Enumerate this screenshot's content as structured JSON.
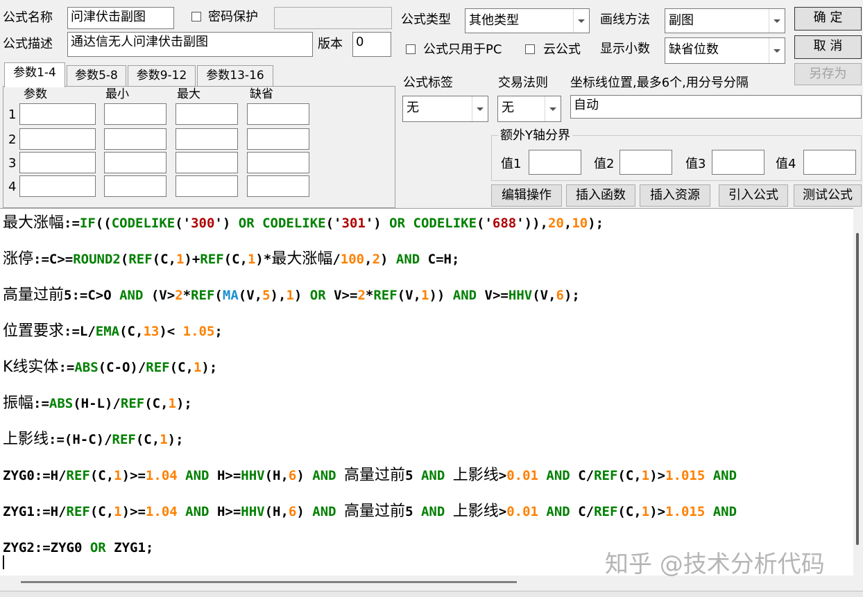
{
  "header": {
    "name_label": "公式名称",
    "name_value": "问津伏击副图",
    "password_label": "密码保护",
    "password_checked": false,
    "desc_label": "公式描述",
    "desc_value": "通达信无人问津伏击副图",
    "version_label": "版本",
    "version_value": "0",
    "type_label": "公式类型",
    "type_value": "其他类型",
    "draw_label": "画线方法",
    "draw_value": "副图",
    "pc_only_label": "公式只用于PC",
    "pc_only_checked": false,
    "cloud_label": "云公式",
    "cloud_checked": false,
    "decimals_label": "显示小数",
    "decimals_value": "缺省位数"
  },
  "buttons": {
    "ok": "确  定",
    "cancel": "取  消",
    "save_as": "另存为",
    "edit_ops": "编辑操作",
    "insert_func": "插入函数",
    "insert_res": "插入资源",
    "import_formula": "引入公式",
    "test_formula": "测试公式"
  },
  "tabs": [
    "参数1-4",
    "参数5-8",
    "参数9-12",
    "参数13-16"
  ],
  "params": {
    "headers": [
      "参数",
      "最小",
      "最大",
      "缺省"
    ],
    "rows": [
      "1",
      "2",
      "3",
      "4"
    ]
  },
  "right": {
    "tag_label": "公式标签",
    "tag_value": "无",
    "rule_label": "交易法则",
    "rule_value": "无",
    "axis_label": "坐标线位置,最多6个,用分号分隔",
    "axis_value": "自动",
    "yaxis_group": "额外Y轴分界",
    "v1": "值1",
    "v2": "值2",
    "v3": "值3",
    "v4": "值4"
  },
  "code": [
    [
      [
        "最大涨幅",
        "cn"
      ],
      [
        ":=",
        ""
      ],
      [
        "IF",
        "f"
      ],
      [
        "((",
        ""
      ],
      [
        "CODELIKE",
        "f"
      ],
      [
        "('",
        ""
      ],
      [
        "300",
        "s"
      ],
      [
        "') ",
        ""
      ],
      [
        "OR",
        "f"
      ],
      [
        " ",
        ""
      ],
      [
        "CODELIKE",
        "f"
      ],
      [
        "('",
        ""
      ],
      [
        "301",
        "s"
      ],
      [
        "') ",
        ""
      ],
      [
        "OR",
        "f"
      ],
      [
        " ",
        ""
      ],
      [
        "CODELIKE",
        "f"
      ],
      [
        "('",
        ""
      ],
      [
        "688",
        "s"
      ],
      [
        "')),",
        ""
      ],
      [
        "20",
        "n"
      ],
      [
        ",",
        ""
      ],
      [
        "10",
        "n"
      ],
      [
        ");",
        ""
      ]
    ],
    [
      [
        "涨停",
        "cn"
      ],
      [
        ":=C>=",
        ""
      ],
      [
        "ROUND2",
        "f"
      ],
      [
        "(",
        ""
      ],
      [
        "REF",
        "f"
      ],
      [
        "(C,",
        ""
      ],
      [
        "1",
        "n"
      ],
      [
        ")+",
        ""
      ],
      [
        "REF",
        "f"
      ],
      [
        "(C,",
        ""
      ],
      [
        "1",
        "n"
      ],
      [
        ")*",
        ""
      ],
      [
        "最大涨幅",
        "cn"
      ],
      [
        "/",
        ""
      ],
      [
        "100",
        "n"
      ],
      [
        ",",
        ""
      ],
      [
        "2",
        "n"
      ],
      [
        ") ",
        ""
      ],
      [
        "AND",
        "f"
      ],
      [
        " C=H;",
        ""
      ]
    ],
    [
      [
        "高量过前",
        "cn"
      ],
      [
        "5:=C>O ",
        ""
      ],
      [
        "AND",
        "f"
      ],
      [
        " (V>",
        ""
      ],
      [
        "2",
        "n"
      ],
      [
        "*",
        ""
      ],
      [
        "REF",
        "f"
      ],
      [
        "(",
        ""
      ],
      [
        "MA",
        "b"
      ],
      [
        "(V,",
        ""
      ],
      [
        "5",
        "n"
      ],
      [
        "),",
        ""
      ],
      [
        "1",
        "n"
      ],
      [
        ") ",
        ""
      ],
      [
        "OR",
        "f"
      ],
      [
        " V>=",
        ""
      ],
      [
        "2",
        "n"
      ],
      [
        "*",
        ""
      ],
      [
        "REF",
        "f"
      ],
      [
        "(V,",
        ""
      ],
      [
        "1",
        "n"
      ],
      [
        ")) ",
        ""
      ],
      [
        "AND",
        "f"
      ],
      [
        " V>=",
        ""
      ],
      [
        "HHV",
        "f"
      ],
      [
        "(V,",
        ""
      ],
      [
        "6",
        "n"
      ],
      [
        ");",
        ""
      ]
    ],
    [
      [
        "位置要求",
        "cn"
      ],
      [
        ":=L/",
        ""
      ],
      [
        "EMA",
        "f"
      ],
      [
        "(C,",
        ""
      ],
      [
        "13",
        "n"
      ],
      [
        ")< ",
        ""
      ],
      [
        "1.05",
        "n"
      ],
      [
        ";",
        ""
      ]
    ],
    [
      [
        "K线实体",
        "cn"
      ],
      [
        ":=",
        ""
      ],
      [
        "ABS",
        "f"
      ],
      [
        "(C-O)/",
        ""
      ],
      [
        "REF",
        "f"
      ],
      [
        "(C,",
        ""
      ],
      [
        "1",
        "n"
      ],
      [
        ");",
        ""
      ]
    ],
    [
      [
        "振幅",
        "cn"
      ],
      [
        ":=",
        ""
      ],
      [
        "ABS",
        "f"
      ],
      [
        "(H-L)/",
        ""
      ],
      [
        "REF",
        "f"
      ],
      [
        "(C,",
        ""
      ],
      [
        "1",
        "n"
      ],
      [
        ");",
        ""
      ]
    ],
    [
      [
        "上影线",
        "cn"
      ],
      [
        ":=(H-C)/",
        ""
      ],
      [
        "REF",
        "f"
      ],
      [
        "(C,",
        ""
      ],
      [
        "1",
        "n"
      ],
      [
        ");",
        ""
      ]
    ],
    [
      [
        "ZYG0:=H/",
        ""
      ],
      [
        "REF",
        "f"
      ],
      [
        "(C,",
        ""
      ],
      [
        "1",
        "n"
      ],
      [
        ")>=",
        ""
      ],
      [
        "1.04",
        "n"
      ],
      [
        " ",
        ""
      ],
      [
        "AND",
        "f"
      ],
      [
        " H>=",
        ""
      ],
      [
        "HHV",
        "f"
      ],
      [
        "(H,",
        ""
      ],
      [
        "6",
        "n"
      ],
      [
        ") ",
        ""
      ],
      [
        "AND",
        "f"
      ],
      [
        " ",
        ""
      ],
      [
        "高量过前",
        "cn"
      ],
      [
        "5 ",
        ""
      ],
      [
        "AND",
        "f"
      ],
      [
        " ",
        ""
      ],
      [
        "上影线",
        "cn"
      ],
      [
        ">",
        ""
      ],
      [
        "0.01",
        "n"
      ],
      [
        " ",
        ""
      ],
      [
        "AND",
        "f"
      ],
      [
        " C/",
        ""
      ],
      [
        "REF",
        "f"
      ],
      [
        "(C,",
        ""
      ],
      [
        "1",
        "n"
      ],
      [
        ")>",
        ""
      ],
      [
        "1.015",
        "n"
      ],
      [
        " ",
        ""
      ],
      [
        "AND",
        "f"
      ]
    ],
    [
      [
        "ZYG1:=H/",
        ""
      ],
      [
        "REF",
        "f"
      ],
      [
        "(C,",
        ""
      ],
      [
        "1",
        "n"
      ],
      [
        ")>=",
        ""
      ],
      [
        "1.04",
        "n"
      ],
      [
        " ",
        ""
      ],
      [
        "AND",
        "f"
      ],
      [
        " H>=",
        ""
      ],
      [
        "HHV",
        "f"
      ],
      [
        "(H,",
        ""
      ],
      [
        "6",
        "n"
      ],
      [
        ") ",
        ""
      ],
      [
        "AND",
        "f"
      ],
      [
        " ",
        ""
      ],
      [
        "高量过前",
        "cn"
      ],
      [
        "5 ",
        ""
      ],
      [
        "AND",
        "f"
      ],
      [
        " ",
        ""
      ],
      [
        "上影线",
        "cn"
      ],
      [
        ">",
        ""
      ],
      [
        "0.01",
        "n"
      ],
      [
        " ",
        ""
      ],
      [
        "AND",
        "f"
      ],
      [
        " C/",
        ""
      ],
      [
        "REF",
        "f"
      ],
      [
        "(C,",
        ""
      ],
      [
        "1",
        "n"
      ],
      [
        ")>",
        ""
      ],
      [
        "1.015",
        "n"
      ],
      [
        " ",
        ""
      ],
      [
        "AND",
        "f"
      ]
    ],
    [
      [
        "ZYG2:=ZYG0 ",
        ""
      ],
      [
        "OR",
        "f"
      ],
      [
        " ZYG1;",
        ""
      ]
    ]
  ],
  "watermark": "知乎 @技术分析代码"
}
